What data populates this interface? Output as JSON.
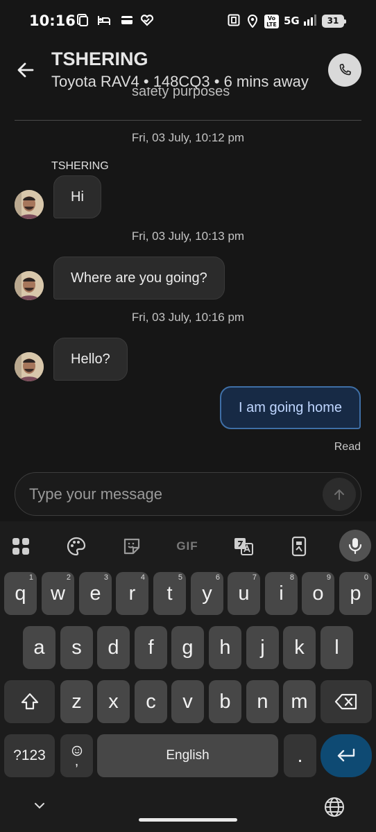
{
  "status_bar": {
    "time": "10:16",
    "network": "5G",
    "volte": "Vo LTE",
    "battery": "31"
  },
  "header": {
    "name": "TSHERING",
    "vehicle_info": "Toyota RAV4 • 148CQ3 • 6 mins away",
    "clipped_text": "safety purposes"
  },
  "chat": {
    "sender_name": "TSHERING",
    "groups": [
      {
        "timestamp": "Fri, 03 July, 10:12 pm",
        "message": "Hi"
      },
      {
        "timestamp": "Fri, 03 July, 10:13 pm",
        "message": "Where are you going?"
      },
      {
        "timestamp": "Fri, 03 July, 10:16 pm",
        "message": "Hello?"
      }
    ],
    "outgoing": {
      "message": "I am going home",
      "status": "Read"
    }
  },
  "composer": {
    "placeholder": "Type your message"
  },
  "keyboard": {
    "toolbar": {
      "gif": "GIF"
    },
    "row1": [
      {
        "key": "q",
        "hint": "1"
      },
      {
        "key": "w",
        "hint": "2"
      },
      {
        "key": "e",
        "hint": "3"
      },
      {
        "key": "r",
        "hint": "4"
      },
      {
        "key": "t",
        "hint": "5"
      },
      {
        "key": "y",
        "hint": "6"
      },
      {
        "key": "u",
        "hint": "7"
      },
      {
        "key": "i",
        "hint": "8"
      },
      {
        "key": "o",
        "hint": "9"
      },
      {
        "key": "p",
        "hint": "0"
      }
    ],
    "row2": [
      "a",
      "s",
      "d",
      "f",
      "g",
      "h",
      "j",
      "k",
      "l"
    ],
    "row3": [
      "z",
      "x",
      "c",
      "v",
      "b",
      "n",
      "m"
    ],
    "symbols_key": "?123",
    "emoji_key_sub": ",",
    "space_label": "English",
    "period_key": "."
  },
  "colors": {
    "background": "#161616",
    "incoming_bubble": "#2b2b2b",
    "outgoing_bubble": "#172a45",
    "outgoing_border": "#3f6fa6",
    "enter_key": "#0e4a73"
  }
}
